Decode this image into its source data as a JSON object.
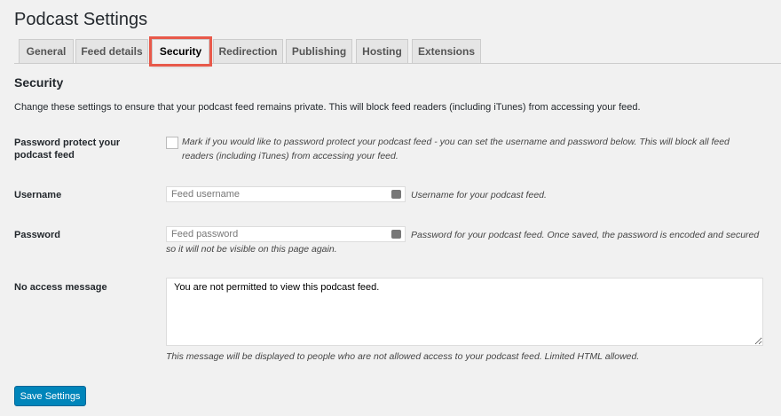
{
  "title": "Podcast Settings",
  "tabs": [
    {
      "label": "General"
    },
    {
      "label": "Feed details"
    },
    {
      "label": "Security"
    },
    {
      "label": "Redirection"
    },
    {
      "label": "Publishing"
    },
    {
      "label": "Hosting"
    },
    {
      "label": "Extensions"
    }
  ],
  "section": {
    "heading": "Security",
    "description": "Change these settings to ensure that your podcast feed remains private. This will block feed readers (including iTunes) from accessing your feed."
  },
  "fields": {
    "protect": {
      "label": "Password protect your podcast feed",
      "note": "Mark if you would like to password protect your podcast feed - you can set the username and password below. This will block all feed readers (including iTunes) from accessing your feed."
    },
    "username": {
      "label": "Username",
      "placeholder": "Feed username",
      "note": "Username for your podcast feed."
    },
    "password": {
      "label": "Password",
      "placeholder": "Feed password",
      "note": "Password for your podcast feed. Once saved, the password is encoded and secured so it will not be visible on this page again."
    },
    "message": {
      "label": "No access message",
      "value": "You are not permitted to view this podcast feed.",
      "note": "This message will be displayed to people who are not allowed access to your podcast feed. Limited HTML allowed."
    }
  },
  "save_label": "Save Settings"
}
